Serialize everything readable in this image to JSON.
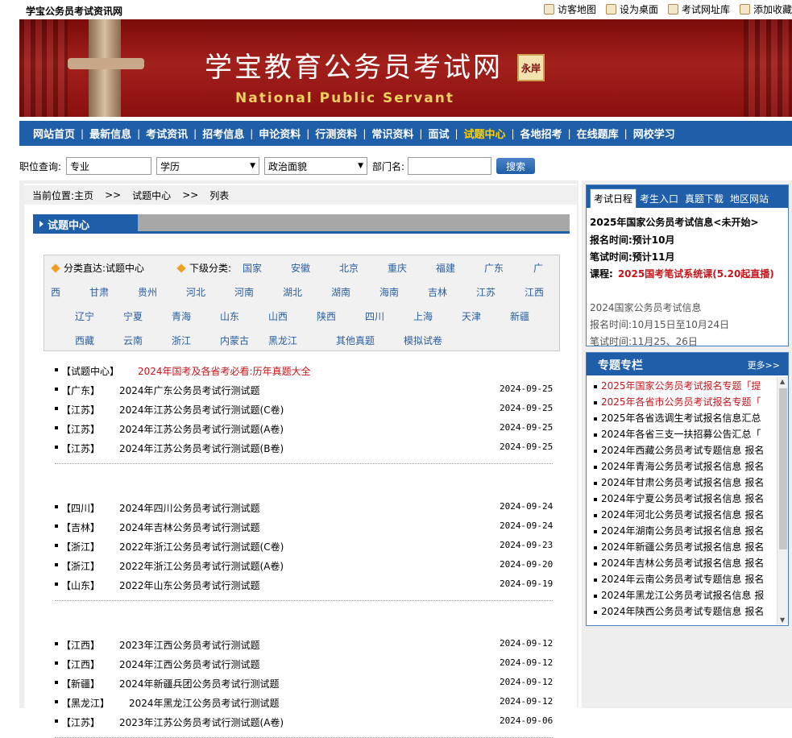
{
  "site_name": "学宝公务员考试资讯网",
  "top_links": [
    "访客地图",
    "设为桌面",
    "考试网址库",
    "添加收藏"
  ],
  "banner": {
    "title": "学宝教育公务员考试网",
    "subtitle": "National Public Servant",
    "seal": "永岸"
  },
  "nav": {
    "items": [
      "网站首页",
      "最新信息",
      "考试资讯",
      "招考信息",
      "申论资料",
      "行测资料",
      "常识资料",
      "面试",
      "试题中心",
      "各地招考",
      "在线题库",
      "网校学习"
    ],
    "active_index": 8
  },
  "query": {
    "label": "职位查询:",
    "major_value": "专业",
    "edu_value": "学历",
    "politics_value": "政治面貌",
    "dept_label": "部门名:",
    "dept_value": "",
    "search_label": "搜索"
  },
  "breadcrumb": {
    "prefix": "当前位置:",
    "home": "主页",
    "sep": ">>",
    "section": "试题中心",
    "page": "列表"
  },
  "section_title": "试题中心",
  "categories": {
    "direct_label": "分类直达:",
    "direct_value": "试题中心",
    "sub_label": "下级分类:",
    "row1": [
      "国家",
      "安徽",
      "北京",
      "重庆",
      "福建",
      "广东",
      "广"
    ],
    "row2": [
      "西",
      "甘肃",
      "贵州",
      "河北",
      "河南",
      "湖北",
      "湖南",
      "海南",
      "吉林",
      "江苏",
      "江西"
    ],
    "row3": [
      "辽宁",
      "宁夏",
      "青海",
      "山东",
      "山西",
      "陕西",
      "四川",
      "上海",
      "天津",
      "新疆"
    ],
    "row4": [
      "西藏",
      "云南",
      "浙江",
      "内蒙古",
      "黑龙江",
      "其他真题",
      "模拟试卷"
    ]
  },
  "featured": {
    "tag": "【试题中心】",
    "title": "2024年国考及各省考必看:历年真题大全"
  },
  "article_groups": [
    [
      {
        "tag": "【广东】",
        "title": "2024年广东公务员考试行测试题",
        "date": "2024-09-25"
      },
      {
        "tag": "【江苏】",
        "title": "2024年江苏公务员考试行测试题(C卷)",
        "date": "2024-09-25"
      },
      {
        "tag": "【江苏】",
        "title": "2024年江苏公务员考试行测试题(A卷)",
        "date": "2024-09-25"
      },
      {
        "tag": "【江苏】",
        "title": "2024年江苏公务员考试行测试题(B卷)",
        "date": "2024-09-25"
      }
    ],
    [
      {
        "tag": "【四川】",
        "title": "2024年四川公务员考试行测试题",
        "date": "2024-09-24"
      },
      {
        "tag": "【吉林】",
        "title": "2024年吉林公务员考试行测试题",
        "date": "2024-09-24"
      },
      {
        "tag": "【浙江】",
        "title": "2022年浙江公务员考试行测试题(C卷)",
        "date": "2024-09-23"
      },
      {
        "tag": "【浙江】",
        "title": "2022年浙江公务员考试行测试题(A卷)",
        "date": "2024-09-20"
      },
      {
        "tag": "【山东】",
        "title": "2022年山东公务员考试行测试题",
        "date": "2024-09-19"
      }
    ],
    [
      {
        "tag": "【江西】",
        "title": "2023年江西公务员考试行测试题",
        "date": "2024-09-12"
      },
      {
        "tag": "【江西】",
        "title": "2024年江西公务员考试行测试题",
        "date": "2024-09-12"
      },
      {
        "tag": "【新疆】",
        "title": "2024年新疆兵团公务员考试行测试题",
        "date": "2024-09-12"
      },
      {
        "tag": "【黑龙江】",
        "title": "2024年黑龙江公务员考试行测试题",
        "date": "2024-09-12"
      },
      {
        "tag": "【江苏】",
        "title": "2023年江苏公务员考试行测试题(A卷)",
        "date": "2024-09-06"
      }
    ]
  ],
  "schedule": {
    "tabs": [
      "考试日程",
      "考生入口",
      "真题下载",
      "地区网站"
    ],
    "headline": "2025年国家公务员考试信息<未开始>",
    "reg": "报名时间:预计10月",
    "exam": "笔试时间:预计11月",
    "course_label": "课程:",
    "course": "2025国考笔试系统课(5.20起直播)",
    "prev_title": "2024国家公务员考试信息",
    "prev_reg": "报名时间:10月15日至10月24日",
    "prev_exam": "笔试时间:11月25、26日"
  },
  "topics": {
    "title": "专题专栏",
    "more": "更多>>",
    "items": [
      "2025年国家公务员考试报名专题「提",
      "2025年各省市公务员考试报名专题「",
      "2025年各省选调生考试报名信息汇总",
      "2024年各省三支一扶招募公告汇总「",
      "2024年西藏公务员考试专题信息 报名",
      "2024年青海公务员考试报名信息 报名",
      "2024年甘肃公务员考试报名信息 报名",
      "2024年宁夏公务员考试报名信息 报名",
      "2024年河北公务员考试报名信息 报名",
      "2024年湖南公务员考试报名信息 报名",
      "2024年新疆公务员考试报名信息 报名",
      "2024年吉林公务员考试报名信息 报名",
      "2024年云南公务员考试专题信息 报名",
      "2024年黑龙江公务员考试报名信息 报",
      "2024年陕西公务员考试专题信息 报名"
    ]
  }
}
